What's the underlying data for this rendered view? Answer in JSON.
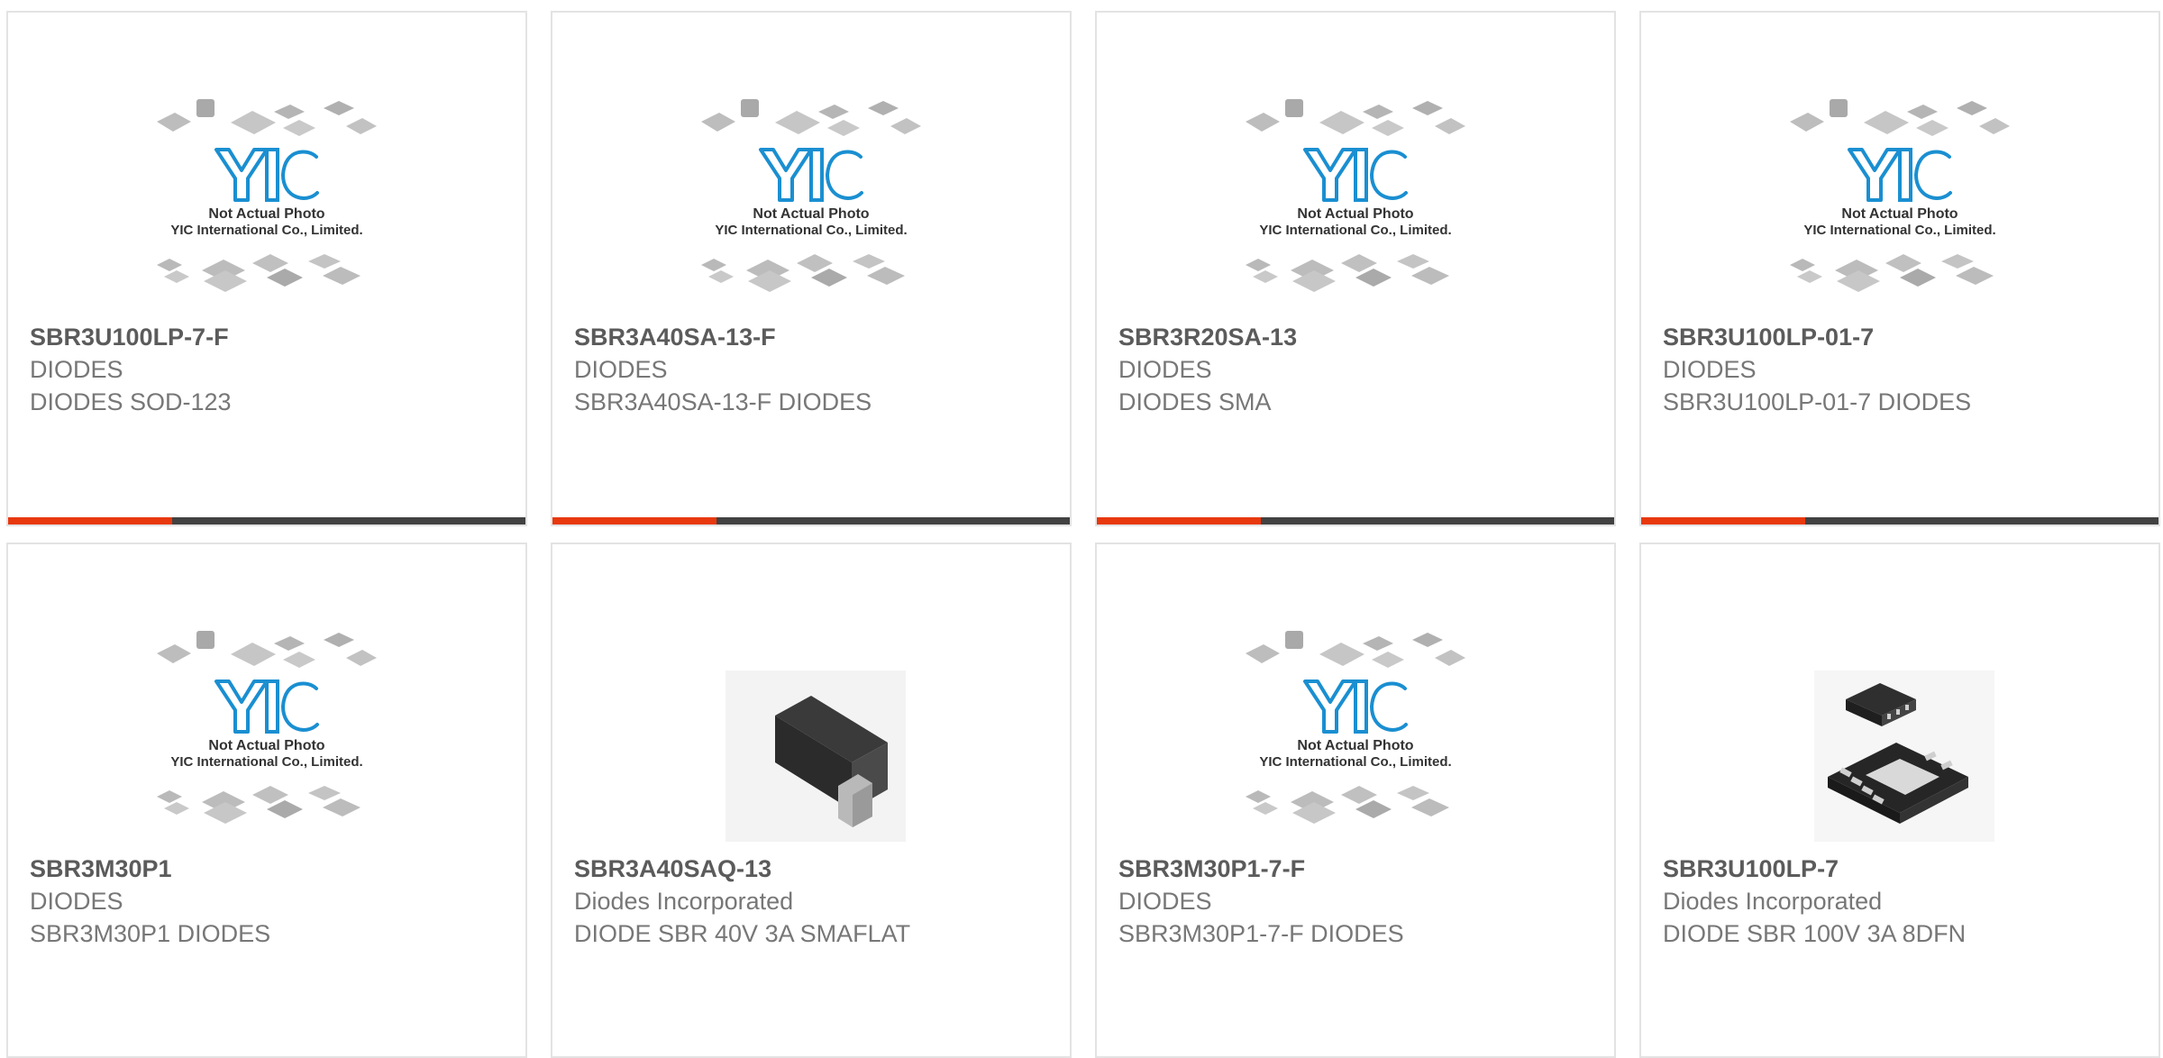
{
  "placeholder_caption": [
    "Not Actual Photo",
    "YIC International Co., Limited."
  ],
  "placeholder_logo": "YIC",
  "colors": {
    "accent": "#e8380d",
    "bar": "#424242",
    "logo": "#1a8fd1"
  },
  "products": [
    {
      "part_number": "SBR3U100LP-7-F",
      "manufacturer": "DIODES",
      "description": "DIODES SOD-123",
      "image": "yic-placeholder"
    },
    {
      "part_number": "SBR3A40SA-13-F",
      "manufacturer": "DIODES",
      "description": "SBR3A40SA-13-F DIODES",
      "image": "yic-placeholder"
    },
    {
      "part_number": "SBR3R20SA-13",
      "manufacturer": "DIODES",
      "description": "DIODES SMA",
      "image": "yic-placeholder"
    },
    {
      "part_number": "SBR3U100LP-01-7",
      "manufacturer": "DIODES",
      "description": "SBR3U100LP-01-7 DIODES",
      "image": "yic-placeholder"
    },
    {
      "part_number": "SBR3M30P1",
      "manufacturer": "DIODES",
      "description": "SBR3M30P1 DIODES",
      "image": "yic-placeholder"
    },
    {
      "part_number": "SBR3A40SAQ-13",
      "manufacturer": "Diodes Incorporated",
      "description": "DIODE SBR 40V 3A SMAFLAT",
      "image": "sma-package"
    },
    {
      "part_number": "SBR3M30P1-7-F",
      "manufacturer": "DIODES",
      "description": "SBR3M30P1-7-F DIODES",
      "image": "yic-placeholder"
    },
    {
      "part_number": "SBR3U100LP-7",
      "manufacturer": "Diodes Incorporated",
      "description": "DIODE SBR 100V 3A 8DFN",
      "image": "dfn-package"
    }
  ]
}
